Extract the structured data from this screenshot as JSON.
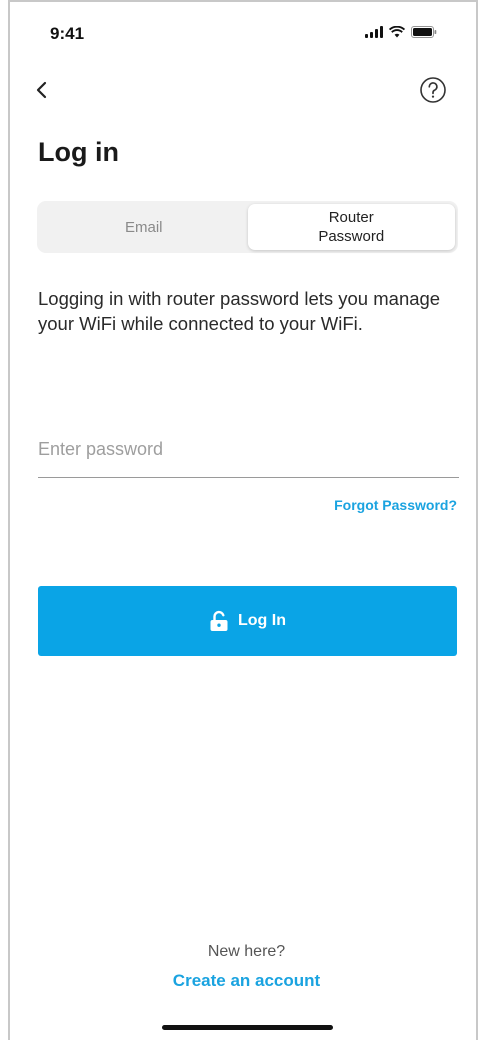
{
  "status_bar": {
    "time": "9:41",
    "icons": [
      "signal-icon",
      "wifi-icon",
      "battery-icon"
    ]
  },
  "nav": {
    "back_icon": "chevron-left-icon",
    "help_icon": "question-circle-icon"
  },
  "page": {
    "title": "Log in"
  },
  "tabs": [
    {
      "label": "Email",
      "selected": false
    },
    {
      "label": "Router\nPassword",
      "selected": true
    }
  ],
  "description": "Logging in with router password lets you manage your WiFi while connected to your WiFi.",
  "password": {
    "value": "",
    "placeholder": "Enter password"
  },
  "forgot_password_label": "Forgot Password?",
  "login_button": {
    "label": "Log In",
    "icon": "lock-icon"
  },
  "footer": {
    "question": "New here?",
    "create_account_label": "Create an account"
  },
  "colors": {
    "accent": "#0aa4e6",
    "link": "#1aa3e0",
    "segment_background": "#f1f1f1"
  }
}
